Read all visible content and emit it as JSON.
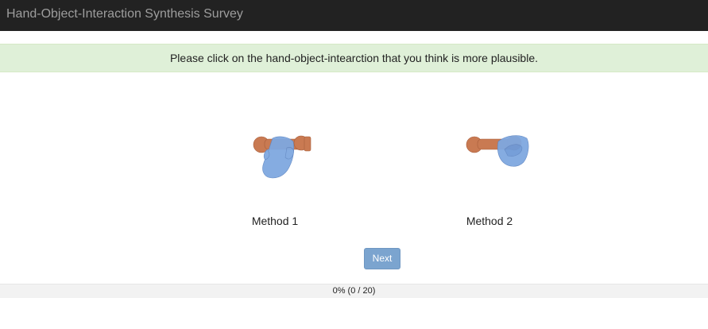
{
  "navbar": {
    "title": "Hand-Object-Interaction Synthesis Survey"
  },
  "instruction": "Please click on the hand-object-intearction that you think is more plausible.",
  "options": [
    {
      "label": "Method 1",
      "image": "hand-object-render"
    },
    {
      "label": "Method 2",
      "image": "hand-object-render"
    }
  ],
  "next_label": "Next",
  "progress": {
    "text": "0% (0 / 20)",
    "fraction": 0
  },
  "colors": {
    "object": "#c97a52",
    "hand": "#7fa8e0",
    "button": "#7ba4cf"
  }
}
